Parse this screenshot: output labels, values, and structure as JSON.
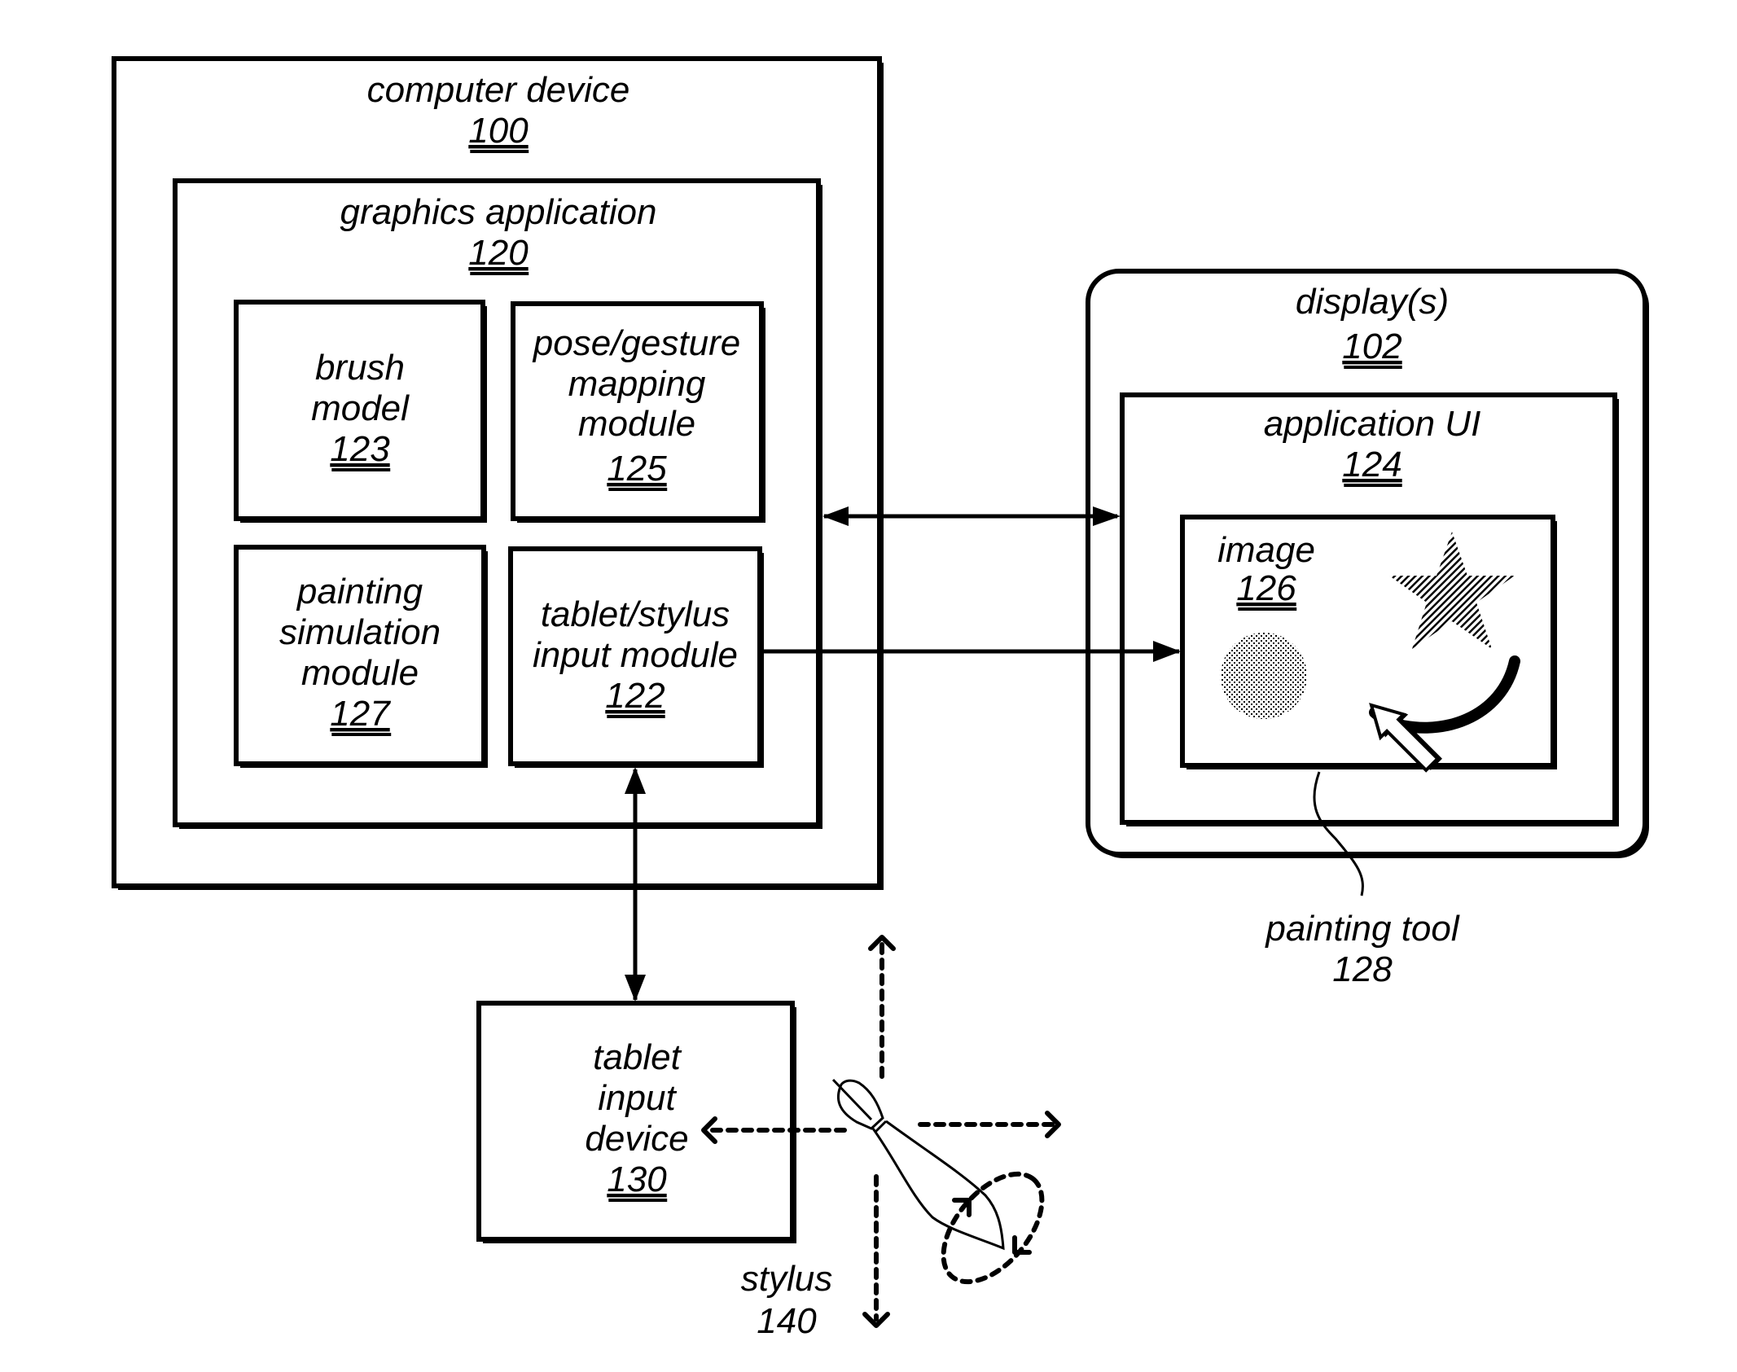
{
  "computer_device": {
    "label": "computer device",
    "ref": "100"
  },
  "graphics_application": {
    "label": "graphics application",
    "ref": "120"
  },
  "brush_model": {
    "lines": [
      "brush",
      "model"
    ],
    "ref": "123"
  },
  "pose_gesture_module": {
    "lines": [
      "pose/gesture",
      "mapping",
      "module"
    ],
    "ref": "125"
  },
  "painting_simulation_module": {
    "lines": [
      "painting",
      "simulation",
      "module"
    ],
    "ref": "127"
  },
  "tablet_stylus_input_module": {
    "lines": [
      "tablet/stylus",
      "input module"
    ],
    "ref": "122"
  },
  "displays": {
    "label": "display(s)",
    "ref": "102"
  },
  "application_ui": {
    "label": "application UI",
    "ref": "124"
  },
  "image": {
    "label": "image",
    "ref": "126"
  },
  "painting_tool": {
    "label": "painting tool",
    "ref": "128"
  },
  "tablet_input_device": {
    "lines": [
      "tablet",
      "input",
      "device"
    ],
    "ref": "130"
  },
  "stylus": {
    "label": "stylus",
    "ref": "140"
  }
}
